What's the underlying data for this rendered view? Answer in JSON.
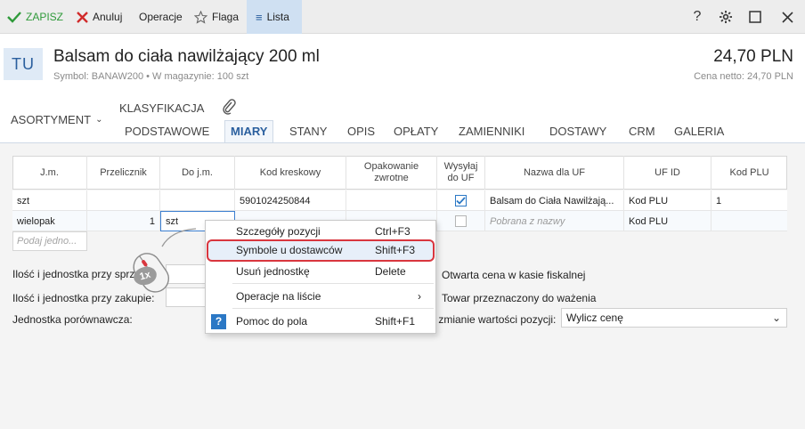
{
  "toolbar": {
    "save": "ZAPISZ",
    "cancel": "Anuluj",
    "operations": "Operacje",
    "flag": "Flaga",
    "list": "Lista"
  },
  "header": {
    "avatar": "TU",
    "title": "Balsam do ciała nawilżający 200 ml",
    "subtitle": "Symbol: BANAW200 • W magazynie: 100 szt",
    "price": "24,70 PLN",
    "netto": "Cena netto: 24,70 PLN"
  },
  "tabs": {
    "asortyment": "ASORTYMENT",
    "klasyfikacja": "KLASYFIKACJA",
    "items": [
      "PODSTAWOWE",
      "MIARY",
      "STANY",
      "OPIS",
      "OPŁATY",
      "ZAMIENNIKI",
      "DOSTAWY",
      "CRM",
      "GALERIA"
    ],
    "active": "MIARY"
  },
  "grid": {
    "headers": [
      "J.m.",
      "Przelicznik",
      "Do j.m.",
      "Kod kreskowy",
      "Opakowanie zwrotne",
      "Wysyłaj do UF",
      "Nazwa dla UF",
      "UF ID",
      "Kod PLU"
    ],
    "rows": [
      {
        "jm": "szt",
        "przelicznik": "",
        "dojm": "",
        "kod": "5901024250844",
        "opak": "",
        "wysylaj": true,
        "nazwa": "Balsam do Ciała Nawilżają...",
        "ufid": "Kod PLU",
        "plu": "1"
      },
      {
        "jm": "wielopak",
        "przelicznik": "1",
        "dojm": "szt",
        "kod": "",
        "opak": "",
        "wysylaj": false,
        "nazwa": "Pobrana z nazwy",
        "ufid": "Kod PLU",
        "plu": ""
      }
    ],
    "new_placeholder": "Podaj jedno..."
  },
  "form": {
    "sale_label": "Ilość i jednostka przy sprz",
    "purchase_label": "Ilość i jednostka przy zakupie:",
    "compare_label": "Jednostka porównawcza:",
    "open_price": "Otwarta cena w kasie fiskalnej",
    "weighing": "Towar przeznaczony do ważenia",
    "change_label": "y zmianie wartości pozycji:",
    "change_value": "Wylicz cenę"
  },
  "context_menu": {
    "items": [
      {
        "label": "Szczegóły pozycji",
        "shortcut": "Ctrl+F3"
      },
      {
        "label": "Symbole u dostawców",
        "shortcut": "Shift+F3"
      },
      {
        "label": "Usuń jednostkę",
        "shortcut": "Delete"
      },
      {
        "label": "Operacje na liście",
        "shortcut": ""
      },
      {
        "label": "Pomoc do pola",
        "shortcut": "Shift+F1"
      }
    ]
  },
  "mouse_badge": "1x",
  "colors": {
    "accent": "#2a5f9e",
    "highlight_border": "#d9363e",
    "toolbar_bg": "#ededed",
    "save_green": "#2f9a3a",
    "cancel_red": "#d12a2a"
  }
}
